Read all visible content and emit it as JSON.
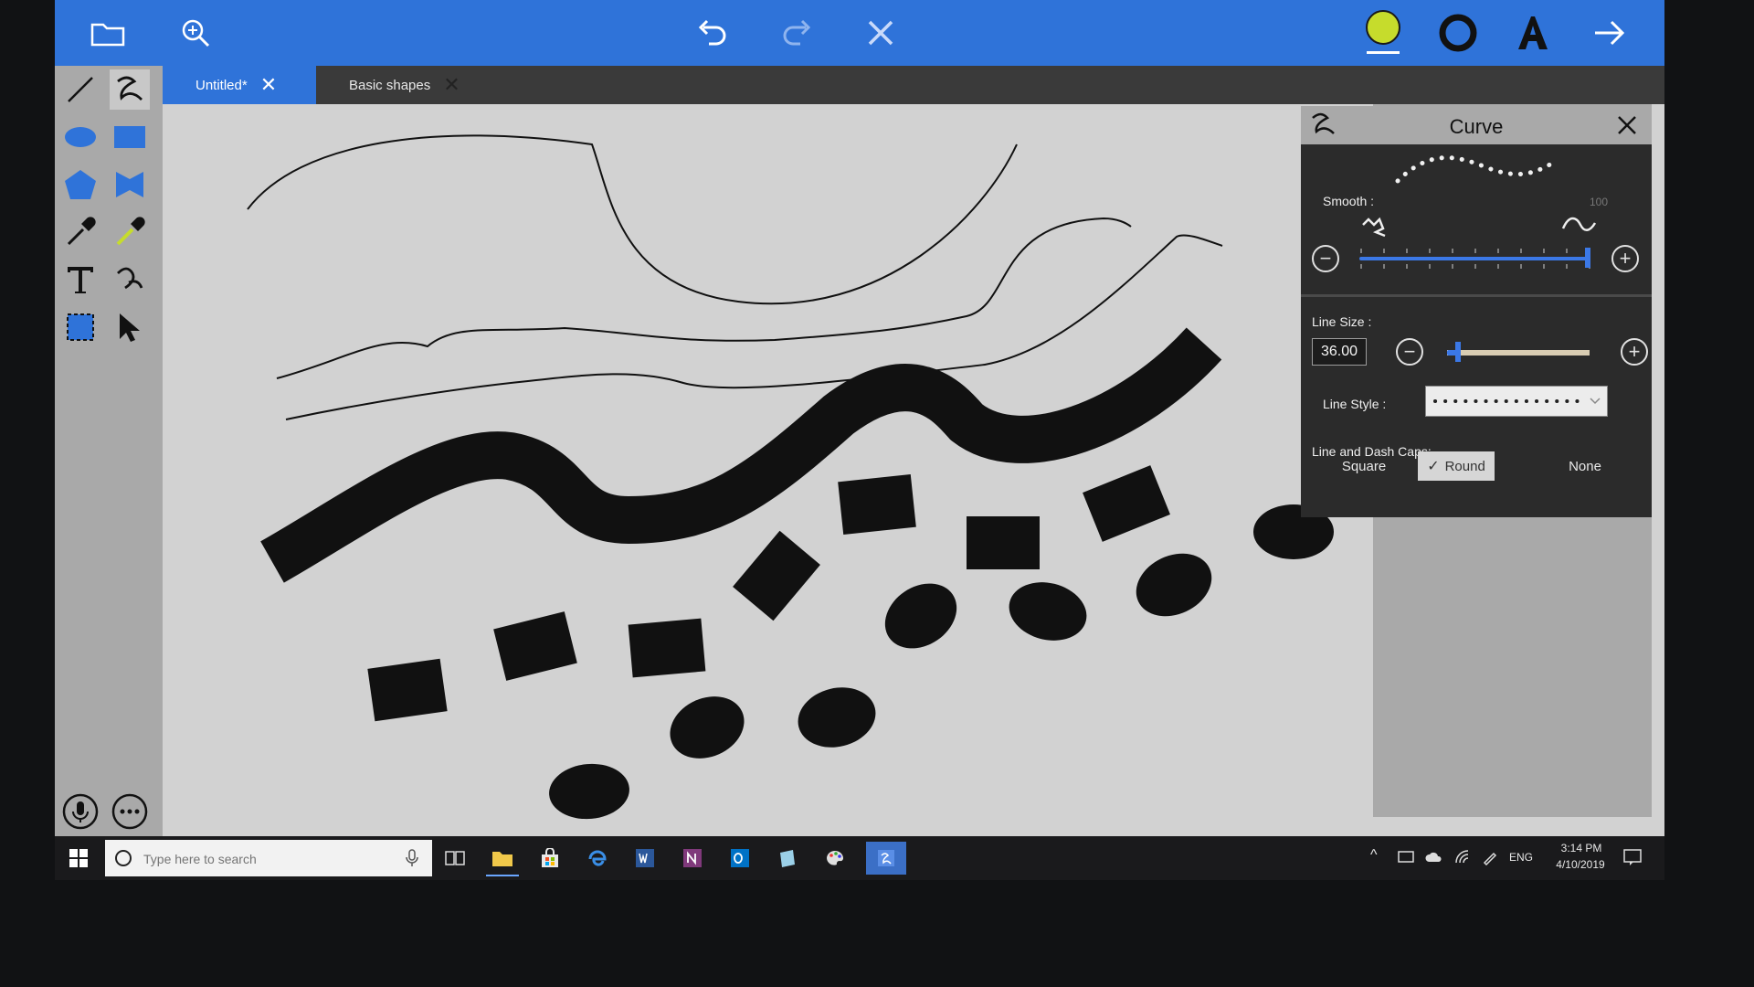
{
  "tabs": [
    {
      "label": "Untitled*",
      "active": true
    },
    {
      "label": "Basic shapes",
      "active": false
    }
  ],
  "topbar": {
    "left_icons": [
      "folder-icon",
      "zoom-icon"
    ],
    "center_icons": [
      "undo-icon",
      "redo-icon",
      "delete-icon"
    ],
    "right_icons": [
      "color-swatch-icon",
      "stroke-ring-icon",
      "text-format-icon",
      "next-arrow-icon"
    ],
    "accent_color": "#2f73d9",
    "swatch_color": "#c6dc2c"
  },
  "tools": [
    "line-tool-icon",
    "curve-tool-icon",
    "ellipse-tool-icon",
    "rectangle-tool-icon",
    "polygon-tool-icon",
    "freeform-shape-tool-icon",
    "eyedropper-icon",
    "color-dropper-icon",
    "text-tool-icon",
    "freehand-tool-icon",
    "select-region-icon",
    "pointer-icon"
  ],
  "curve_panel": {
    "title": "Curve",
    "smooth_label": "Smooth :",
    "smooth_max": "100",
    "smooth_value": 1.0,
    "line_size_label": "Line Size :",
    "line_size_value": "36.00",
    "line_size_level": 0.08,
    "line_style_label": "Line Style :",
    "line_style_value": "dotted",
    "caps_label": "Line and Dash Caps:",
    "caps": [
      {
        "label": "Square",
        "selected": false
      },
      {
        "label": "Round",
        "selected": true
      },
      {
        "label": "None",
        "selected": false
      }
    ]
  },
  "taskbar": {
    "search_placeholder": "Type here to search",
    "apps": [
      "task-view-icon",
      "file-explorer-icon",
      "store-icon",
      "edge-icon",
      "word-icon",
      "onenote-icon",
      "outlook-icon",
      "notepad-icon",
      "paint-icon",
      "sketch-app-icon"
    ],
    "language": "ENG",
    "time": "3:14 PM",
    "date": "4/10/2019"
  },
  "bottom_buttons": [
    "microphone-icon",
    "more-options-icon"
  ]
}
